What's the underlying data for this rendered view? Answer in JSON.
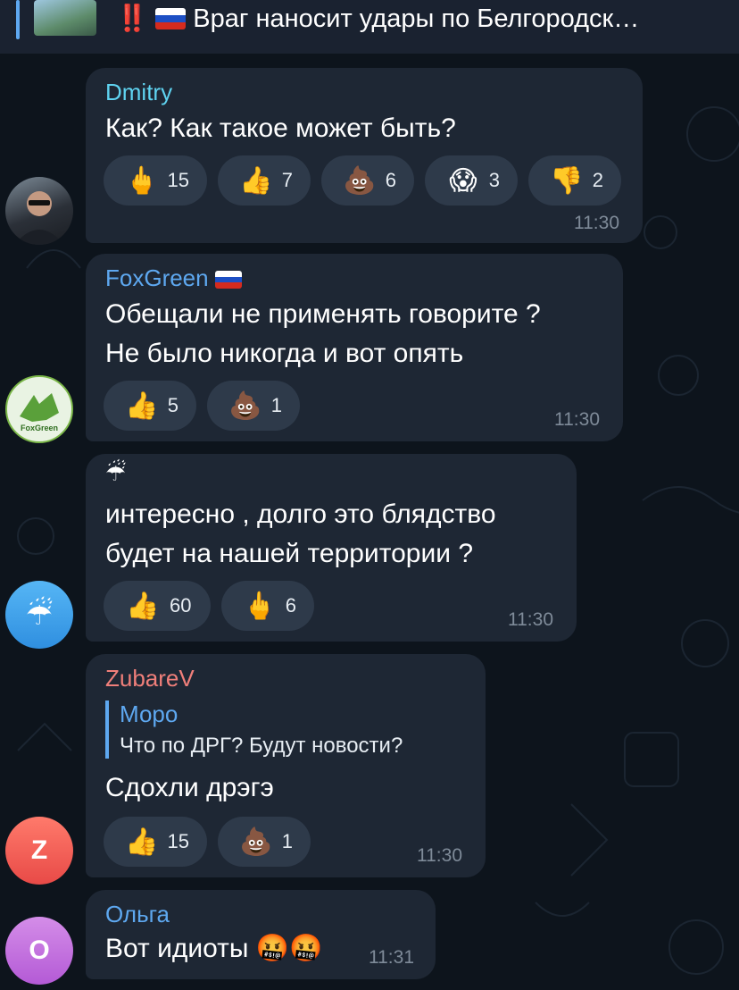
{
  "pinned": {
    "alert": "‼️",
    "text": "Враг наносит удары по Белгородск…"
  },
  "messages": [
    {
      "sender": "Dmitry",
      "sender_color": "#5fd3f0",
      "text": "Как? Как такое может быть?",
      "time": "11:30",
      "reactions": [
        {
          "emoji": "🖕",
          "icon": "middle-finger-icon",
          "count": "15"
        },
        {
          "emoji": "👍",
          "icon": "thumbs-up-icon",
          "count": "7"
        },
        {
          "emoji": "💩",
          "icon": "poop-icon",
          "count": "6"
        },
        {
          "emoji": "😱",
          "icon": "screaming-face-icon",
          "count": "3"
        },
        {
          "emoji": "👎",
          "icon": "thumbs-down-icon",
          "count": "2"
        }
      ]
    },
    {
      "sender": "FoxGreen",
      "sender_color": "#5ea8f0",
      "text1": "Обещали не применять говорите ?",
      "text2": "Не было никогда и вот опять",
      "time": "11:30",
      "avatar_label": "FoxGreen",
      "reactions": [
        {
          "emoji": "👍",
          "icon": "thumbs-up-icon",
          "count": "5"
        },
        {
          "emoji": "💩",
          "icon": "poop-icon",
          "count": "1"
        }
      ]
    },
    {
      "sender": "☔",
      "text1": "интересно , долго это блядство",
      "text2": "будет на нашей территории ?",
      "time": "11:30",
      "avatar_emoji": "☔",
      "reactions": [
        {
          "emoji": "👍",
          "icon": "thumbs-up-icon",
          "count": "60"
        },
        {
          "emoji": "🖕",
          "icon": "middle-finger-icon",
          "count": "6"
        }
      ]
    },
    {
      "sender": "ZubareV",
      "sender_color": "#f07f7a",
      "reply_name": "Моро",
      "reply_text": "Что по ДРГ? Будут новости?",
      "text": "Сдохли дрэгэ",
      "time": "11:30",
      "avatar_letter": "Z",
      "reactions": [
        {
          "emoji": "👍",
          "icon": "thumbs-up-icon",
          "count": "15"
        },
        {
          "emoji": "💩",
          "icon": "poop-icon",
          "count": "1"
        }
      ]
    },
    {
      "sender": "Ольга",
      "sender_color": "#5ea8f0",
      "text": "Вот идиоты 🤬🤬",
      "time": "11:31",
      "avatar_letter": "О"
    }
  ]
}
